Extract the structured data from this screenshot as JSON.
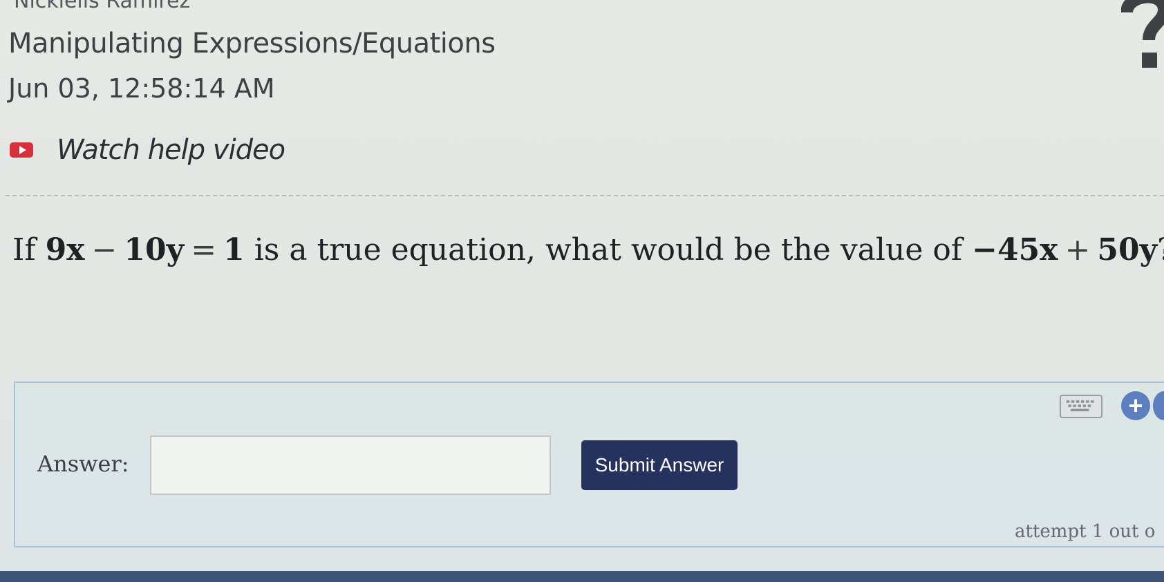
{
  "header": {
    "student_name": "Nickiells Ramirez",
    "topic": "Manipulating Expressions/Equations",
    "timestamp": "Jun 03, 12:58:14 AM",
    "help_video_label": "Watch help video"
  },
  "question": {
    "prefix": "If",
    "eq_a": "9x",
    "op1": "−",
    "eq_b": "10y",
    "op2": "=",
    "eq_c": "1",
    "middle": "is a true equation, what would be the value of",
    "expr_a": "−45x",
    "op3": "+",
    "expr_b": "50y",
    "suffix": "?"
  },
  "answer": {
    "label": "Answer:",
    "value": "",
    "submit_label": "Submit Answer",
    "attempt_text": "attempt 1 out o"
  },
  "colors": {
    "submit_button": "#26325e",
    "video_icon": "#d7303a",
    "panel_border": "#a8c0d6"
  },
  "icons": [
    "help-icon",
    "video-icon",
    "keyboard-icon",
    "add-icon"
  ]
}
